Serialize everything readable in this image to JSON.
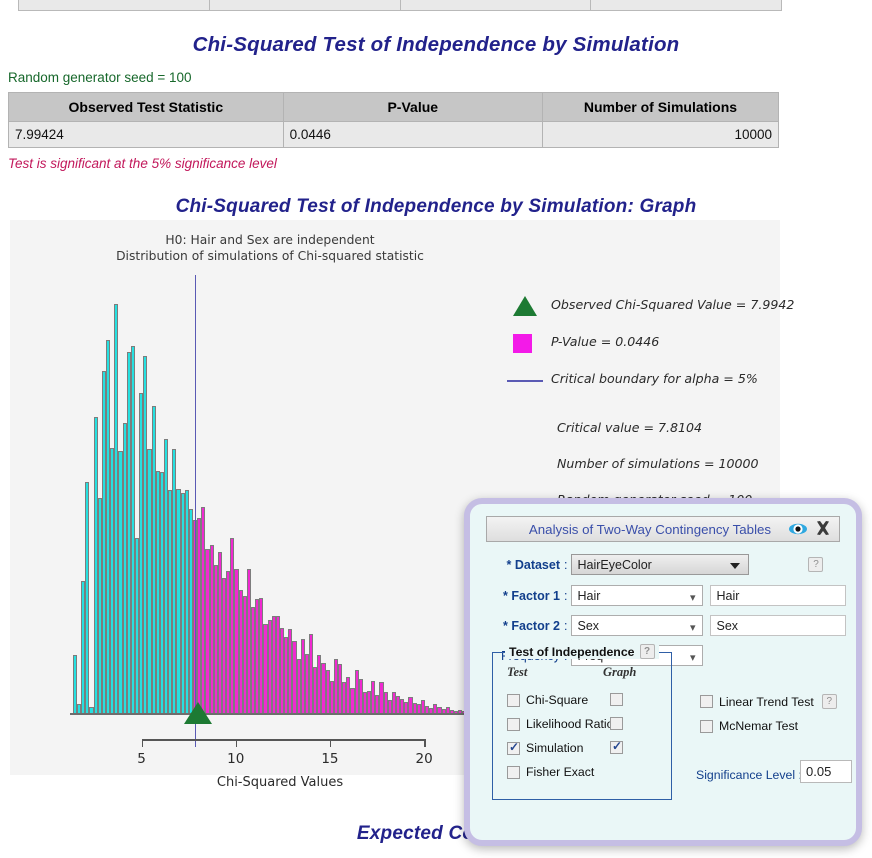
{
  "page": {
    "main_title": "Chi-Squared Test of Independence by Simulation",
    "graph_title": "Chi-Squared Test of Independence by Simulation: Graph",
    "expected_title": "Expected Counts",
    "seed_line": "Random generator seed = 100",
    "significance_note": "Test is significant at the 5% significance level"
  },
  "results_table": {
    "headers": [
      "Observed Test Statistic",
      "P-Value",
      "Number of Simulations"
    ],
    "row": [
      "7.99424",
      "0.0446",
      "10000"
    ]
  },
  "chart_data": {
    "type": "bar",
    "title": "Chi-Squared Test of Independence by Simulation: Graph",
    "subtitle_line1": "H0: Hair and Sex are independent",
    "subtitle_line2": "Distribution of simulations of Chi-squared statistic",
    "xlabel": "Chi-Squared Values",
    "ylabel": "",
    "xticks": [
      "5",
      "10",
      "15",
      "20"
    ],
    "xtick_values": [
      5,
      10,
      15,
      20
    ],
    "xlim": [
      1.2,
      23.5
    ],
    "ylim": [
      0,
      470
    ],
    "grid": false,
    "legend_position": "right",
    "bin_width": 0.22,
    "bin_start": 1.35,
    "critical_value": 7.8104,
    "observed_value": 7.9942,
    "colors": {
      "below_critical": "#26e0e0",
      "above_critical": "#ef2ad0",
      "critical_line": "#5a5ab4",
      "observed_marker": "#1d7a33"
    },
    "values": [
      66,
      12,
      148,
      258,
      9,
      330,
      240,
      380,
      415,
      295,
      455,
      292,
      323,
      402,
      408,
      196,
      356,
      397,
      294,
      342,
      270,
      269,
      305,
      249,
      294,
      250,
      246,
      249,
      228,
      216,
      218,
      230,
      184,
      188,
      166,
      180,
      152,
      159,
      196,
      162,
      138,
      132,
      162,
      119,
      128,
      129,
      101,
      105,
      110,
      109,
      96,
      86,
      95,
      82,
      62,
      84,
      68,
      90,
      53,
      66,
      58,
      50,
      38,
      62,
      56,
      36,
      42,
      30,
      50,
      40,
      25,
      27,
      38,
      22,
      36,
      25,
      17,
      26,
      21,
      18,
      14,
      20,
      13,
      12,
      17,
      10,
      8,
      12,
      9,
      7,
      9,
      6,
      4,
      6,
      4,
      3,
      5,
      3,
      2,
      3
    ],
    "legend_entries": [
      {
        "symbol": "triangle",
        "text": "Observed Chi-Squared Value = 7.9942"
      },
      {
        "symbol": "square",
        "text": "P-Value = 0.0446"
      },
      {
        "symbol": "line",
        "text": "Critical boundary for  alpha  =  5%"
      }
    ],
    "legend_notes": [
      " Critical value = 7.8104",
      "Number of simulations = 10000",
      "Random generator seed = 100"
    ]
  },
  "dialog": {
    "title": "Analysis of Two-Way Contingency Tables",
    "icons": {
      "eye": "eye-icon",
      "close": "close-icon"
    },
    "fields": {
      "dataset_label": "* Dataset",
      "dataset_value": "HairEyeColor",
      "factor1_label": "* Factor 1",
      "factor1_value": "Hair",
      "factor1_text": "Hair",
      "factor2_label": "* Factor 2",
      "factor2_value": "Sex",
      "factor2_text": "Sex",
      "frequency_label": "Frequency",
      "frequency_value": "Freq"
    },
    "fieldset": {
      "legend": "Test of Independence",
      "help": "?",
      "col_test": "Test",
      "col_graph": "Graph",
      "rows": [
        {
          "label": "Chi-Square",
          "test_checked": false,
          "graph_checked": false
        },
        {
          "label": "Likelihood Ratio",
          "test_checked": false,
          "graph_checked": false
        },
        {
          "label": "Simulation",
          "test_checked": true,
          "graph_checked": true
        },
        {
          "label": "Fisher Exact",
          "test_checked": false,
          "graph_checked": false
        }
      ]
    },
    "right_options": [
      {
        "label": "Linear Trend Test",
        "checked": false,
        "has_help": true
      },
      {
        "label": "McNemar Test",
        "checked": false,
        "has_help": false
      }
    ],
    "significance": {
      "label": "Significance Level :",
      "value": "0.05"
    },
    "help_symbol": "?"
  }
}
